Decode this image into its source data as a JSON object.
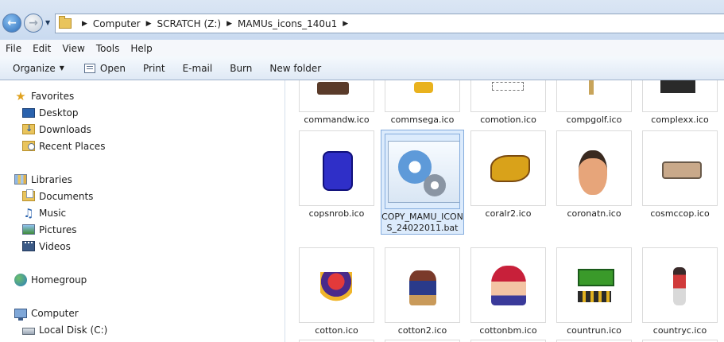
{
  "address": {
    "path": [
      "Computer",
      "SCRATCH (Z:)",
      "MAMUs_icons_140u1"
    ]
  },
  "menu": [
    "File",
    "Edit",
    "View",
    "Tools",
    "Help"
  ],
  "toolbar": {
    "organize": "Organize",
    "open": "Open",
    "print": "Print",
    "email": "E-mail",
    "burn": "Burn",
    "new_folder": "New folder"
  },
  "nav": {
    "favorites": "Favorites",
    "desktop": "Desktop",
    "downloads": "Downloads",
    "recent_places": "Recent Places",
    "libraries": "Libraries",
    "documents": "Documents",
    "music": "Music",
    "pictures": "Pictures",
    "videos": "Videos",
    "homegroup": "Homegroup",
    "computer": "Computer",
    "local_disk": "Local Disk (C:)"
  },
  "files": {
    "row1": [
      "commandw.ico",
      "commsega.ico",
      "comotion.ico",
      "compgolf.ico",
      "complexx.ico"
    ],
    "row2": [
      "copsnrob.ico",
      "COPY_MAMU_ICONS_24022011.bat",
      "coralr2.ico",
      "coronatn.ico",
      "cosmccop.ico"
    ],
    "row3": [
      "cotton.ico",
      "cotton2.ico",
      "cottonbm.ico",
      "countrun.ico",
      "countryc.ico"
    ]
  },
  "selected_file": "COPY_MAMU_ICONS_24022011.bat",
  "colors": {
    "selection": "#dcebfc",
    "selection_border": "#84acdd",
    "addressbar": "#c9daf0"
  }
}
